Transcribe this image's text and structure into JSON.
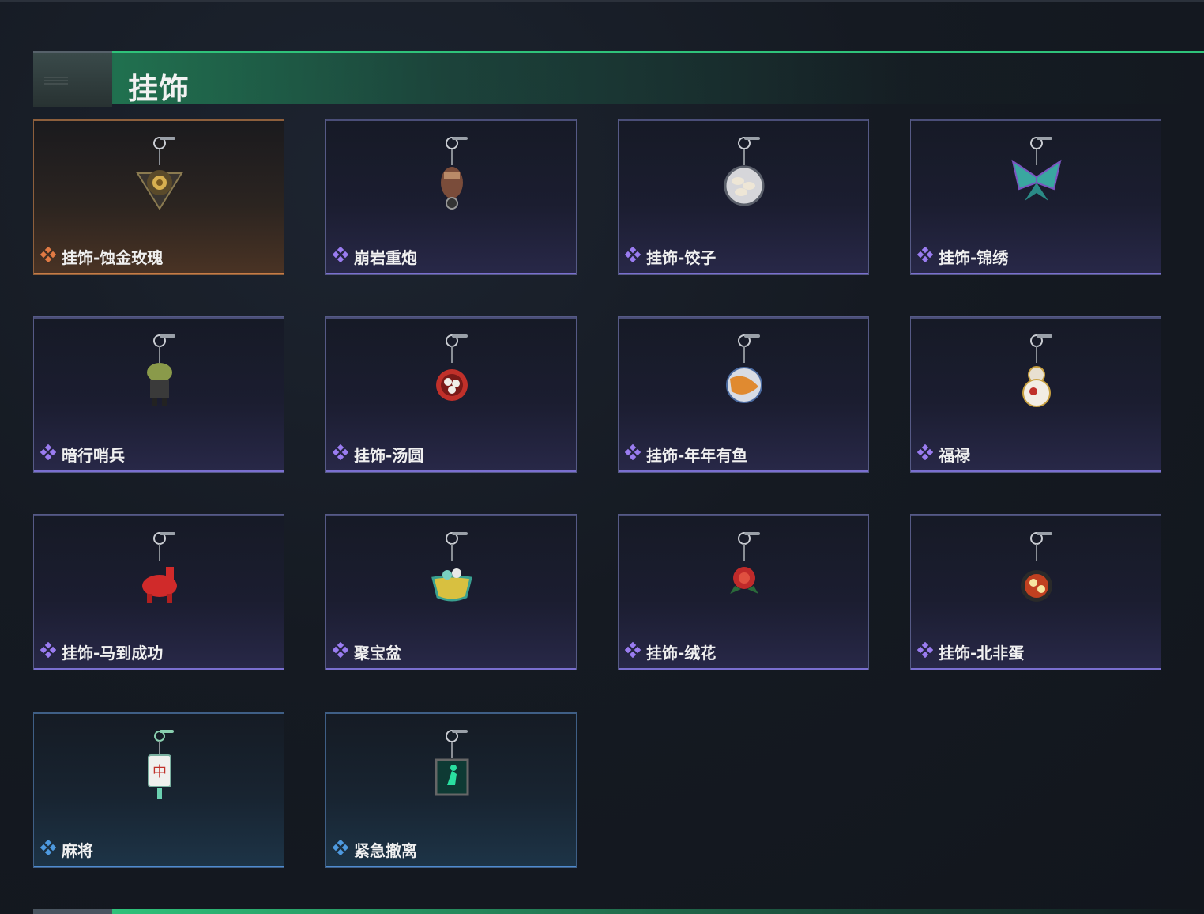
{
  "section": {
    "title": "挂饰"
  },
  "items": [
    {
      "name": "挂饰-蚀金玫瑰",
      "rarity": "gold",
      "icon": "rose-pendant-icon"
    },
    {
      "name": "崩岩重炮",
      "rarity": "purple",
      "icon": "cannon-pendant-icon"
    },
    {
      "name": "挂饰-饺子",
      "rarity": "purple",
      "icon": "dumpling-plate-icon"
    },
    {
      "name": "挂饰-锦绣",
      "rarity": "purple",
      "icon": "butterfly-pendant-icon"
    },
    {
      "name": "暗行哨兵",
      "rarity": "purple",
      "icon": "sentinel-figure-icon"
    },
    {
      "name": "挂饰-汤圆",
      "rarity": "purple",
      "icon": "tangyuan-bowl-icon"
    },
    {
      "name": "挂饰-年年有鱼",
      "rarity": "purple",
      "icon": "fish-plate-icon"
    },
    {
      "name": "福禄",
      "rarity": "purple",
      "icon": "gourd-pendant-icon"
    },
    {
      "name": "挂饰-马到成功",
      "rarity": "purple",
      "icon": "red-horse-icon"
    },
    {
      "name": "聚宝盆",
      "rarity": "purple",
      "icon": "treasure-bowl-icon"
    },
    {
      "name": "挂饰-绒花",
      "rarity": "purple",
      "icon": "velvet-flower-icon"
    },
    {
      "name": "挂饰-北非蛋",
      "rarity": "purple",
      "icon": "shakshuka-pan-icon"
    },
    {
      "name": "麻将",
      "rarity": "blue",
      "icon": "mahjong-tile-icon"
    },
    {
      "name": "紧急撤离",
      "rarity": "blue",
      "icon": "evacuation-sign-icon"
    }
  ],
  "colors": {
    "accent": "#2fc27a",
    "gold": "#e07a44",
    "purple": "#9a7cf0",
    "blue": "#4e9ae0"
  }
}
